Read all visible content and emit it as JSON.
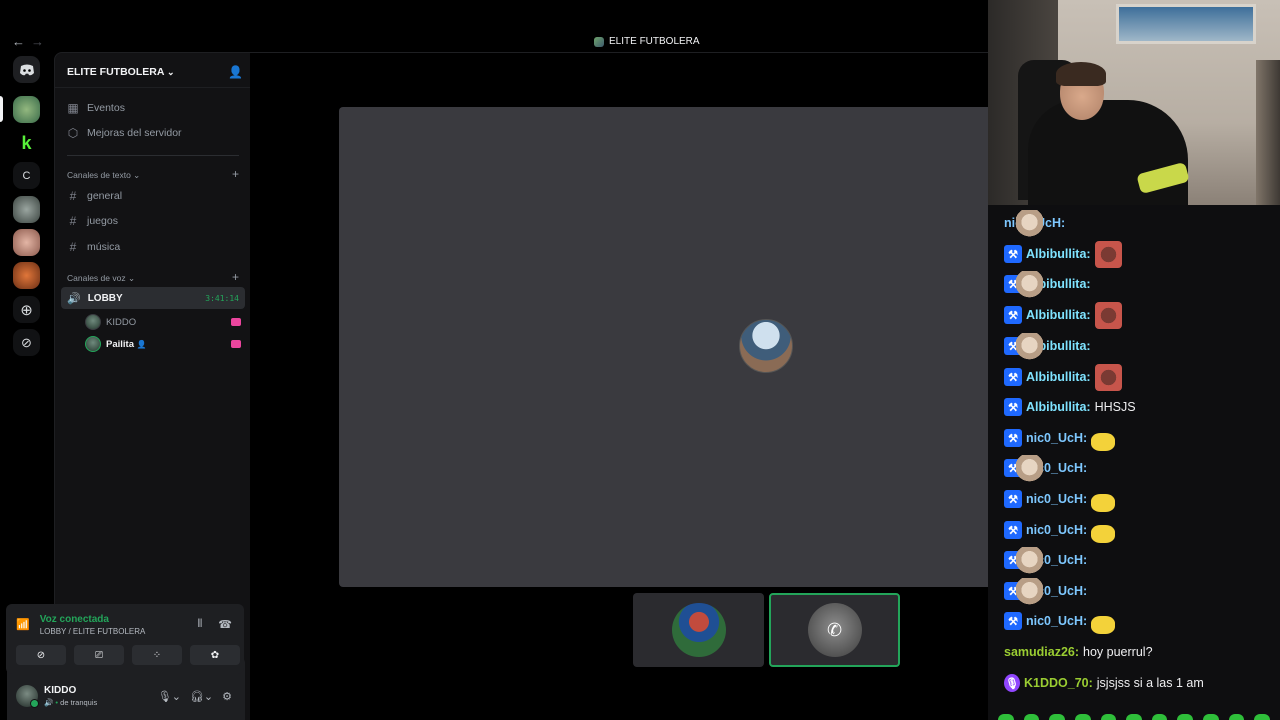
{
  "window": {
    "title": "ELITE FUTBOLERA",
    "nav_back": "←",
    "nav_forward": "→"
  },
  "server": {
    "name": "ELITE FUTBOLERA",
    "rail_letter": "C"
  },
  "menu": {
    "events": "Eventos",
    "boosts": "Mejoras del servidor"
  },
  "text_category": "Canales de texto",
  "text_channels": [
    "general",
    "juegos",
    "música"
  ],
  "voice_category": "Canales de voz",
  "voice_channel": {
    "name": "LOBBY",
    "timer": "3:41:14"
  },
  "members": [
    {
      "name": "KIDDO"
    },
    {
      "name": "Pailita"
    }
  ],
  "voice_panel": {
    "title": "Voz conectada",
    "subtitle": "LOBBY / ELITE FUTBOLERA"
  },
  "user": {
    "name": "KIDDO",
    "status": "de tranquis"
  },
  "chat": [
    {
      "user": "nic0_UcH",
      "color": "#7ec8ff",
      "badge": false,
      "text": "",
      "emotes": [
        "cat",
        "cat",
        "cat",
        "cat",
        "cat"
      ]
    },
    {
      "user": "Albibullita",
      "color": "#7fe3ff",
      "badge": true,
      "text": "",
      "emotes": [
        "face"
      ]
    },
    {
      "user": "Albibullita",
      "color": "#7fe3ff",
      "badge": true,
      "text": "",
      "emotes": [
        "cat"
      ]
    },
    {
      "user": "Albibullita",
      "color": "#7fe3ff",
      "badge": true,
      "text": "",
      "emotes": [
        "face"
      ]
    },
    {
      "user": "Albibullita",
      "color": "#7fe3ff",
      "badge": true,
      "text": "",
      "emotes": [
        "cat"
      ]
    },
    {
      "user": "Albibullita",
      "color": "#7fe3ff",
      "badge": true,
      "text": "",
      "emotes": [
        "face"
      ]
    },
    {
      "user": "Albibullita",
      "color": "#7fe3ff",
      "badge": true,
      "text": "HHSJS",
      "emotes": []
    },
    {
      "user": "nic0_UcH",
      "color": "#7ec8ff",
      "badge": true,
      "text": "",
      "emotes": [
        "duck"
      ]
    },
    {
      "user": "nic0_UcH",
      "color": "#7ec8ff",
      "badge": true,
      "text": "",
      "emotes": [
        "cat"
      ]
    },
    {
      "user": "nic0_UcH",
      "color": "#7ec8ff",
      "badge": true,
      "text": "",
      "emotes": [
        "duck"
      ]
    },
    {
      "user": "nic0_UcH",
      "color": "#7ec8ff",
      "badge": true,
      "text": "",
      "emotes": [
        "duck"
      ]
    },
    {
      "user": "nic0_UcH",
      "color": "#7ec8ff",
      "badge": true,
      "text": "",
      "emotes": [
        "cat"
      ]
    },
    {
      "user": "nic0_UcH",
      "color": "#7ec8ff",
      "badge": true,
      "text": "",
      "emotes": [
        "cat"
      ]
    },
    {
      "user": "nic0_UcH",
      "color": "#7ec8ff",
      "badge": true,
      "text": "",
      "emotes": [
        "duck"
      ]
    },
    {
      "user": "samudiaz26",
      "color": "#9acd32",
      "badge": false,
      "text": "hoy puerrul?",
      "emotes": []
    },
    {
      "user": "K1DDO_70",
      "color": "#9acd32",
      "badge": "purple",
      "text": "jsjsjss si a las 1 am",
      "emotes": []
    }
  ],
  "colors": {
    "green": "#23a55a",
    "sidebar": "#121214",
    "stage": "#3a3a3f",
    "chat_bg": "#0e0e10"
  }
}
